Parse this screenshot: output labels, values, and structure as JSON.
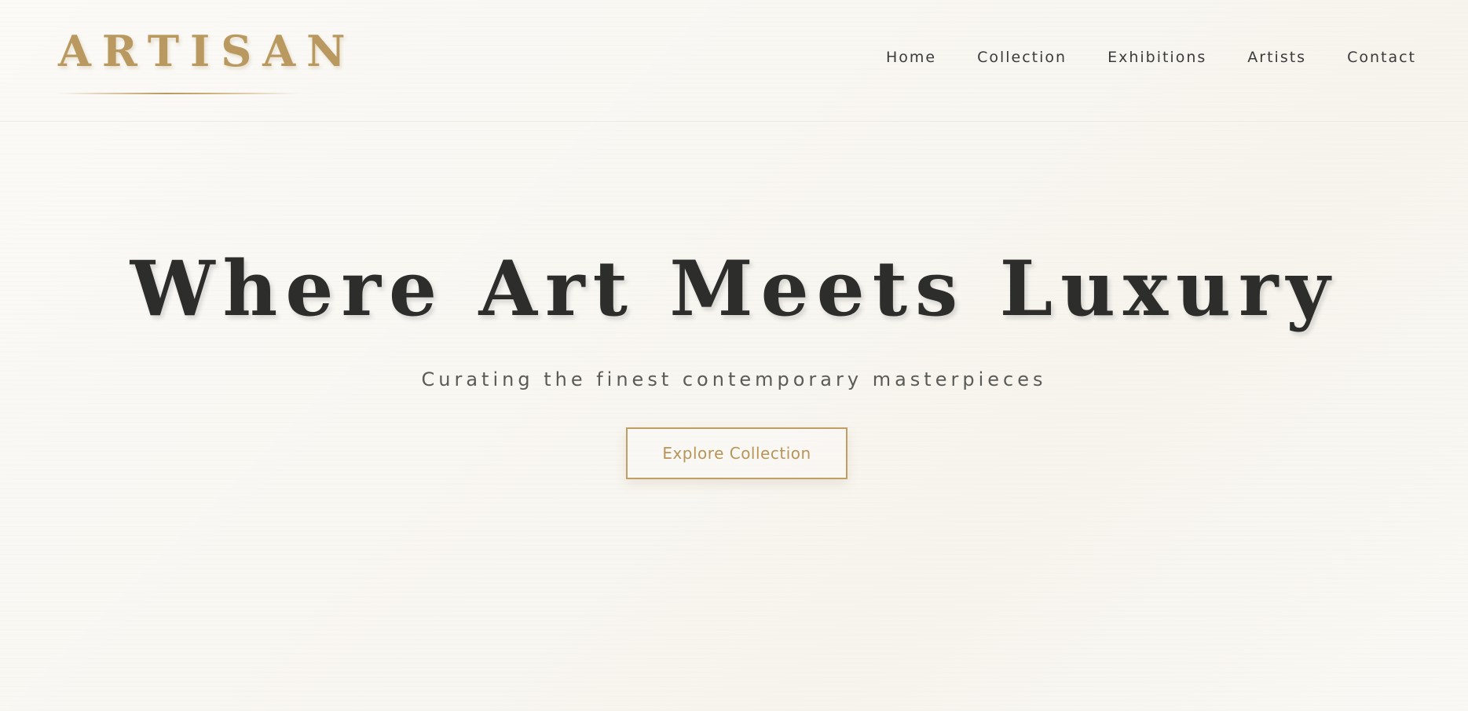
{
  "brand": {
    "logo_text": "ARTISAN",
    "accent_color": "#b9995f"
  },
  "nav": {
    "items": [
      {
        "label": "Home"
      },
      {
        "label": "Collection"
      },
      {
        "label": "Exhibitions"
      },
      {
        "label": "Artists"
      },
      {
        "label": "Contact"
      }
    ]
  },
  "hero": {
    "title": "Where Art Meets Luxury",
    "subtitle": "Curating the finest contemporary masterpieces",
    "cta_label": "Explore Collection"
  },
  "colors": {
    "background": "#f9f7f2",
    "text_dark": "#2d2d2b",
    "gold": "#bf9f64"
  }
}
